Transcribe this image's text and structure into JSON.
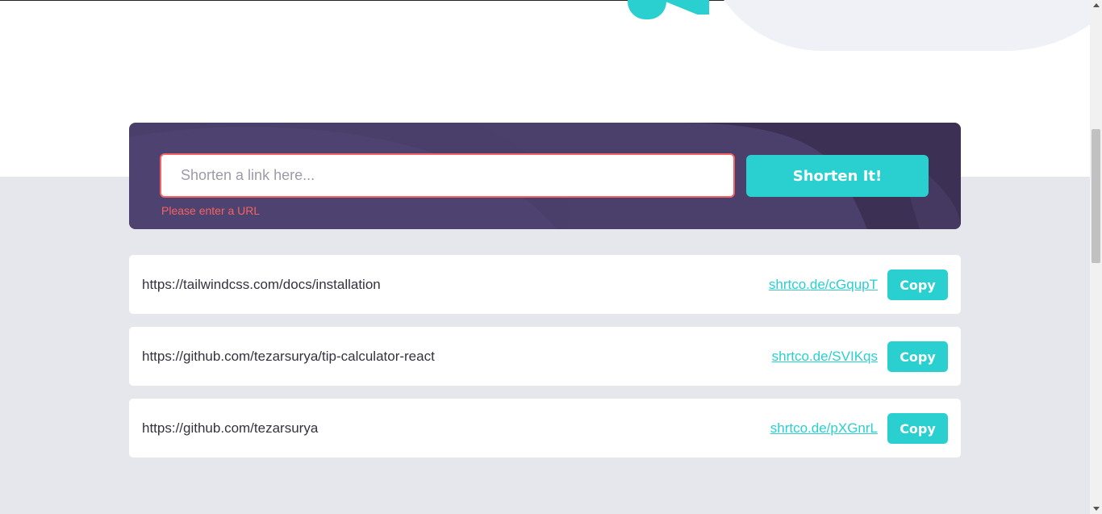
{
  "shortener": {
    "placeholder": "Shorten a link here...",
    "value": "",
    "button_label": "Shorten It!",
    "error": "Please enter a URL"
  },
  "links": [
    {
      "original": "https://tailwindcss.com/docs/installation",
      "short": "shrtco.de/cGqupT",
      "copy_label": "Copy"
    },
    {
      "original": "https://github.com/tezarsurya/tip-calculator-react",
      "short": "shrtco.de/SVIKqs",
      "copy_label": "Copy"
    },
    {
      "original": "https://github.com/tezarsurya",
      "short": "shrtco.de/pXGnrL",
      "copy_label": "Copy"
    }
  ],
  "colors": {
    "accent": "#2acfcf",
    "dark_violet": "#4b3f6b",
    "error": "#f46262",
    "section_bg": "#e6e7ec"
  },
  "icons": {
    "scroll_up": "scroll-up-arrow-icon",
    "scroll_down": "scroll-down-arrow-icon"
  }
}
